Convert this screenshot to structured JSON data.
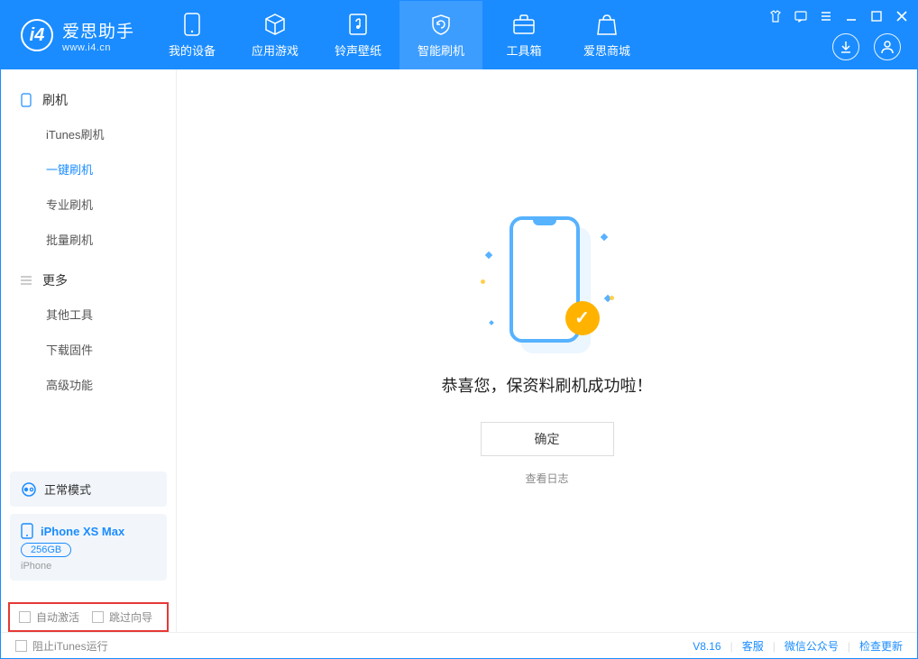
{
  "app": {
    "name": "爱思助手",
    "url": "www.i4.cn"
  },
  "tabs": {
    "device": "我的设备",
    "apps": "应用游戏",
    "ring": "铃声壁纸",
    "flash": "智能刷机",
    "toolbox": "工具箱",
    "store": "爱思商城"
  },
  "sidebar": {
    "group_flash": "刷机",
    "items_flash": {
      "itunes": "iTunes刷机",
      "onekey": "一键刷机",
      "pro": "专业刷机",
      "batch": "批量刷机"
    },
    "group_more": "更多",
    "items_more": {
      "other": "其他工具",
      "firmware": "下载固件",
      "advanced": "高级功能"
    }
  },
  "mode_card": "正常模式",
  "device": {
    "name": "iPhone XS Max",
    "storage": "256GB",
    "type": "iPhone"
  },
  "options": {
    "auto_activate": "自动激活",
    "skip_guide": "跳过向导"
  },
  "main": {
    "success": "恭喜您，保资料刷机成功啦！",
    "ok": "确定",
    "view_log": "查看日志"
  },
  "footer": {
    "block_itunes": "阻止iTunes运行",
    "version": "V8.16",
    "support": "客服",
    "wechat": "微信公众号",
    "update": "检查更新"
  }
}
